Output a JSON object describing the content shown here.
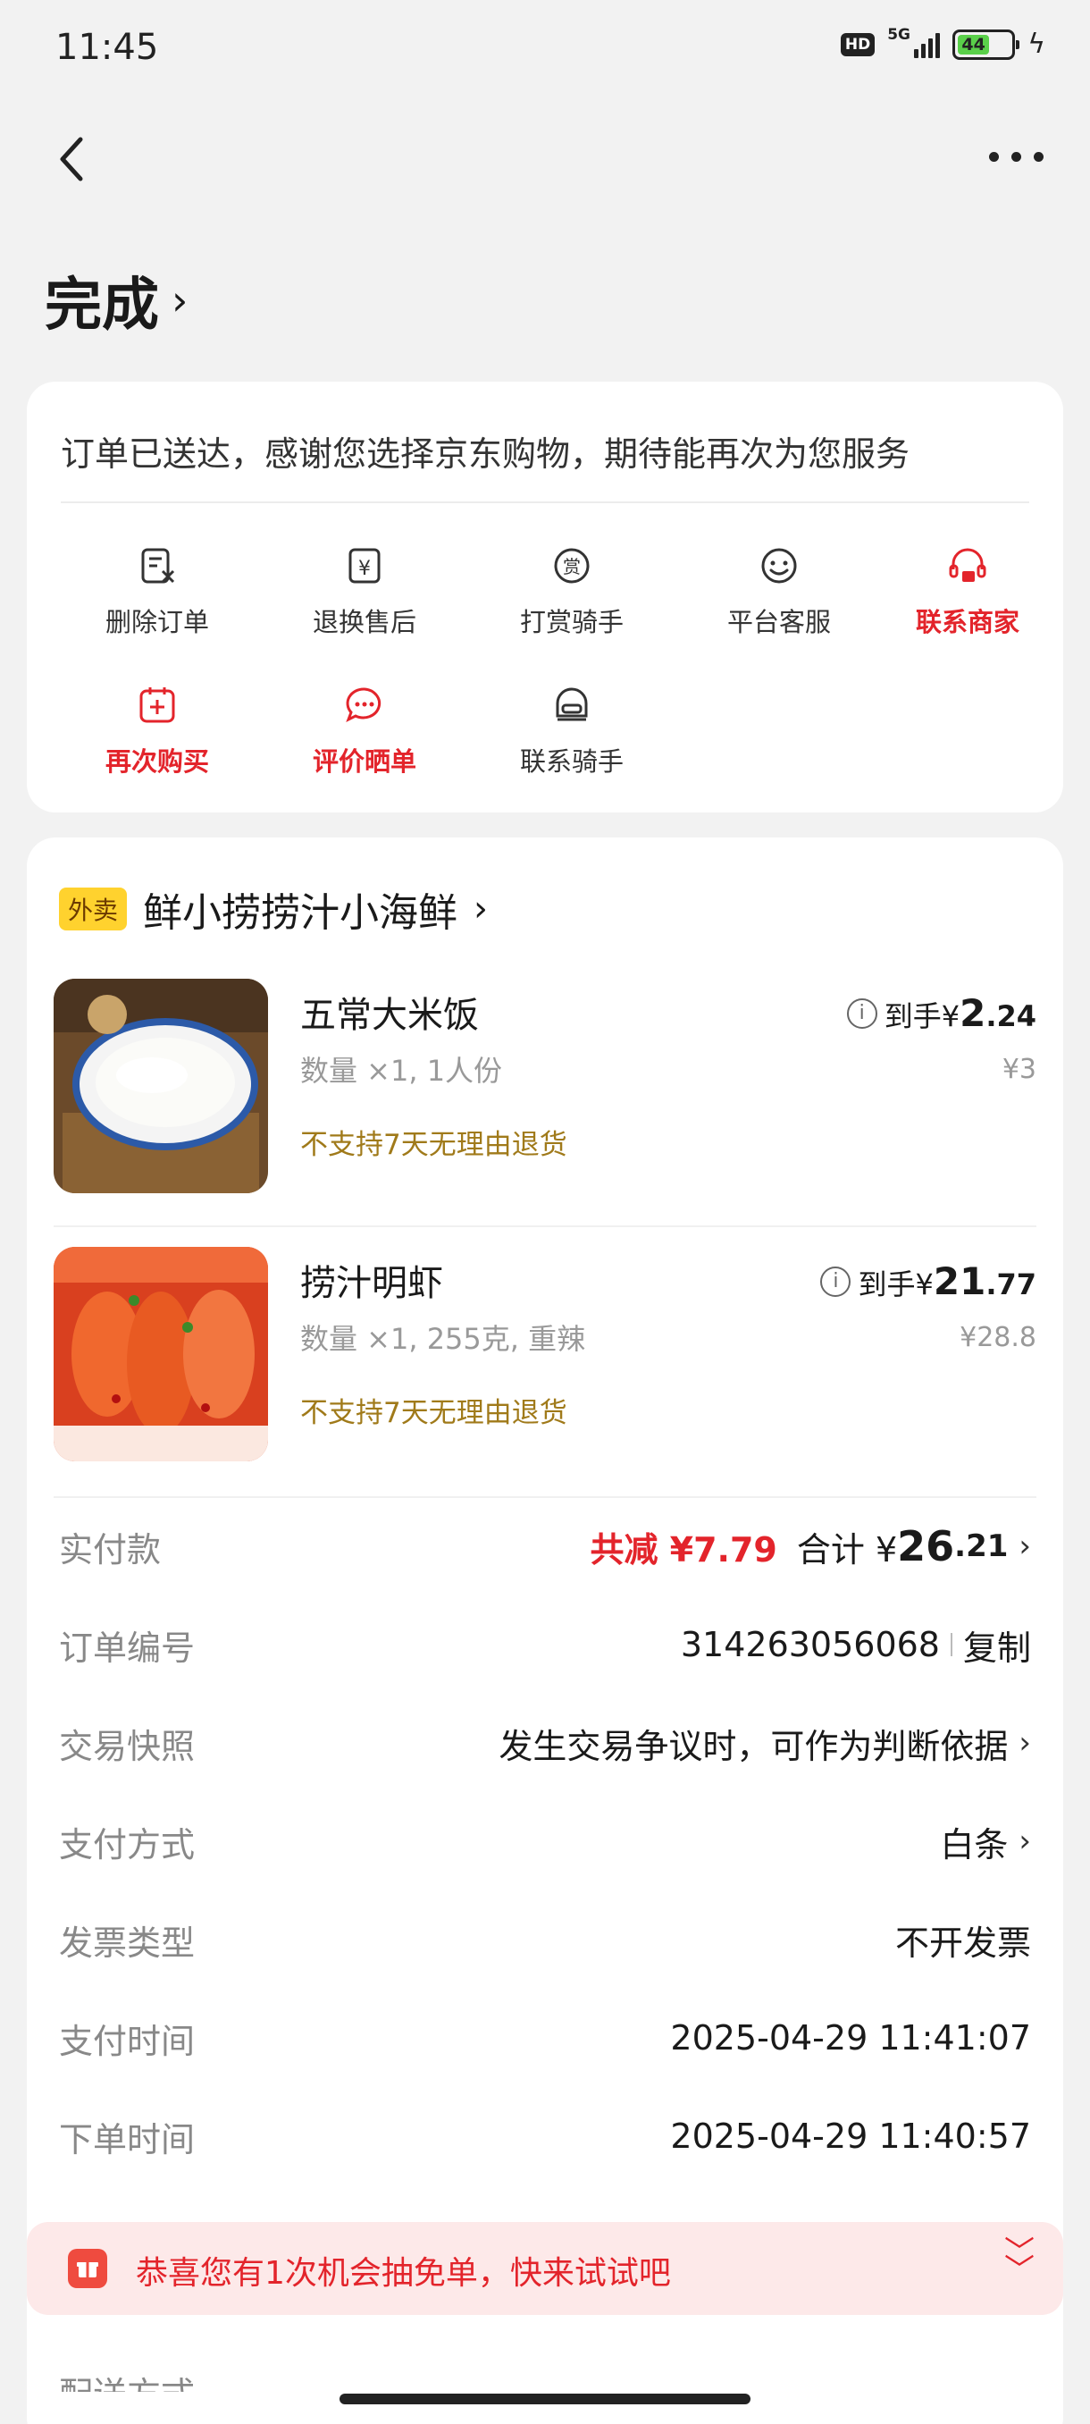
{
  "status_bar": {
    "time": "11:45",
    "network": "5G",
    "hd": "HD",
    "battery": "44"
  },
  "header": {
    "title": "完成"
  },
  "notice": {
    "message": "订单已送达，感谢您选择京东购物，期待能再次为您服务"
  },
  "actions": [
    {
      "label": "删除订单",
      "icon": "delete-order-icon",
      "highlight": false
    },
    {
      "label": "退换售后",
      "icon": "refund-icon",
      "highlight": false
    },
    {
      "label": "打赏骑手",
      "icon": "reward-icon",
      "highlight": false
    },
    {
      "label": "平台客服",
      "icon": "service-icon",
      "highlight": false
    },
    {
      "label": "联系商家",
      "icon": "store-contact-icon",
      "highlight": true
    },
    {
      "label": "再次购买",
      "icon": "buy-again-icon",
      "highlight": true
    },
    {
      "label": "评价晒单",
      "icon": "review-icon",
      "highlight": true
    },
    {
      "label": "联系骑手",
      "icon": "rider-contact-icon",
      "highlight": false
    }
  ],
  "store": {
    "tag": "外卖",
    "name": "鲜小捞捞汁小海鲜"
  },
  "items": [
    {
      "name": "五常大米饭",
      "spec": "数量 ×1, 1人份",
      "note": "不支持7天无理由退货",
      "price_prefix": "到手¥",
      "price_int": "2",
      "price_dec": ".24",
      "original": "¥3"
    },
    {
      "name": "捞汁明虾",
      "spec": "数量 ×1, 255克, 重辣",
      "note": "不支持7天无理由退货",
      "price_prefix": "到手¥",
      "price_int": "21",
      "price_dec": ".77",
      "original": "¥28.8"
    }
  ],
  "payment": {
    "label": "实付款",
    "discount": "共减 ¥7.79",
    "total_prefix": "合计 ¥",
    "total_int": "26",
    "total_dec": ".21"
  },
  "details": {
    "order_no": {
      "label": "订单编号",
      "value": "314263056068",
      "action": "复制"
    },
    "snapshot": {
      "label": "交易快照",
      "value": "发生交易争议时，可作为判断依据"
    },
    "pay_method": {
      "label": "支付方式",
      "value": "白条"
    },
    "invoice": {
      "label": "发票类型",
      "value": "不开发票"
    },
    "pay_time": {
      "label": "支付时间",
      "value": "2025-04-29 11:41:07"
    },
    "order_time": {
      "label": "下单时间",
      "value": "2025-04-29 11:40:57"
    }
  },
  "promo": {
    "text": "恭喜您有1次机会抽免单，快来试试吧"
  },
  "cutoff_label": "配送方式",
  "colors": {
    "accent": "#e3242b",
    "note": "#a07a1a",
    "tag_bg": "#ffd22e",
    "promo_bg": "#fde9e9"
  }
}
